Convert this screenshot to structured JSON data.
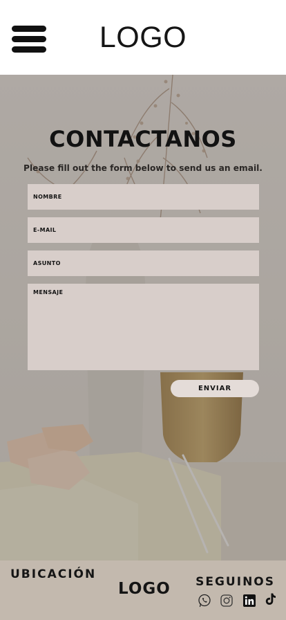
{
  "header": {
    "menu_icon": "hamburger-menu-icon",
    "logo": "LOGO"
  },
  "contact": {
    "title": "CONTACTANOS",
    "subtitle": "Please fill out the form below to send us an email.",
    "fields": {
      "nombre_placeholder": "NOMBRE",
      "email_placeholder": "E-MAIL",
      "asunto_placeholder": "ASUNTO",
      "mensaje_placeholder": "MENSAJE"
    },
    "send_label": "ENVIAR"
  },
  "footer": {
    "location_label": "UBICACIÓN",
    "logo": "LOGO",
    "follow_label": "SEGUINOS",
    "social_icons": [
      "whatsapp-icon",
      "instagram-icon",
      "linkedin-icon",
      "tiktok-icon"
    ]
  },
  "colors": {
    "header_bg": "#ffffff",
    "field_bg": "#d8ceca",
    "button_bg": "#e4dcd8",
    "footer_bg": "#c3b9ae",
    "text": "#151515"
  }
}
